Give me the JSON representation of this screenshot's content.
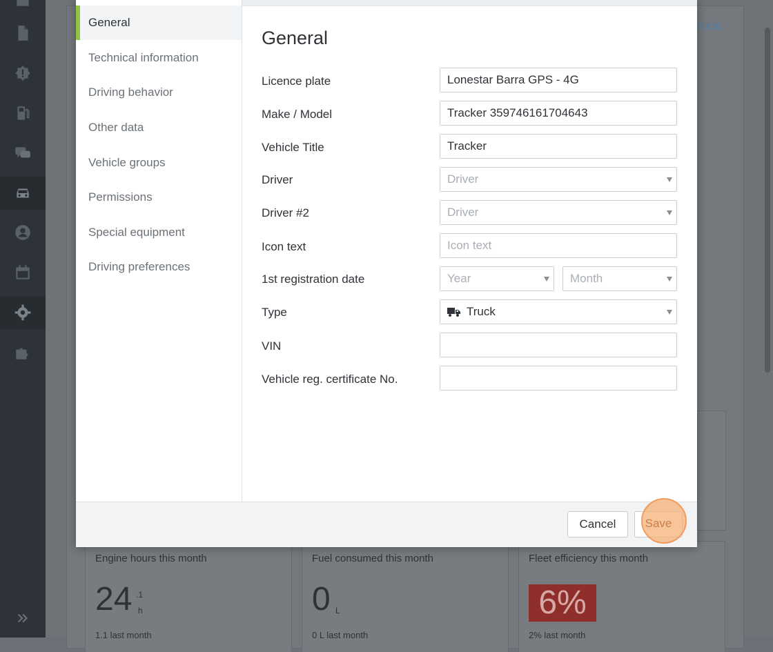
{
  "background": {
    "top_right_link": "hicle",
    "cards": [
      {
        "title": "Engine hours this month",
        "value": "24",
        "sup": ".1",
        "unit": "h",
        "foot": "1.1 last month"
      },
      {
        "title": "Fuel consumed this month",
        "value": "0",
        "unit": "L",
        "foot": "0 L last month"
      },
      {
        "title": "Fleet efficiency this month",
        "value": "6%",
        "foot": "2% last month",
        "badge_color": "#8e2f2b"
      }
    ]
  },
  "sidebar_icons": [
    "document-icon",
    "alert-icon",
    "fuel-icon",
    "chat-icon",
    "car-icon",
    "user-icon",
    "calendar-icon",
    "gear-icon",
    "plugin-icon"
  ],
  "modal": {
    "nav": [
      {
        "label": "General",
        "active": true
      },
      {
        "label": "Technical information"
      },
      {
        "label": "Driving behavior"
      },
      {
        "label": "Other data"
      },
      {
        "label": "Vehicle groups"
      },
      {
        "label": "Permissions"
      },
      {
        "label": "Special equipment"
      },
      {
        "label": "Driving preferences"
      }
    ],
    "title": "General",
    "fields": {
      "licence_plate": {
        "label": "Licence plate",
        "value": "Lonestar Barra GPS - 4G"
      },
      "make_model": {
        "label": "Make / Model",
        "value": "Tracker 359746161704643"
      },
      "vehicle_title": {
        "label": "Vehicle Title",
        "value": "Tracker"
      },
      "driver": {
        "label": "Driver",
        "placeholder": "Driver"
      },
      "driver2": {
        "label": "Driver #2",
        "placeholder": "Driver"
      },
      "icon_text": {
        "label": "Icon text",
        "placeholder": "Icon text"
      },
      "registration": {
        "label": "1st registration date",
        "year_placeholder": "Year",
        "month_placeholder": "Month"
      },
      "type": {
        "label": "Type",
        "value": "Truck"
      },
      "vin": {
        "label": "VIN",
        "value": ""
      },
      "reg_cert": {
        "label": "Vehicle reg. certificate No.",
        "value": ""
      }
    },
    "footer": {
      "cancel": "Cancel",
      "save": "Save"
    },
    "accent_color": "#8dc63f",
    "highlight_color": "#f29b5c"
  }
}
